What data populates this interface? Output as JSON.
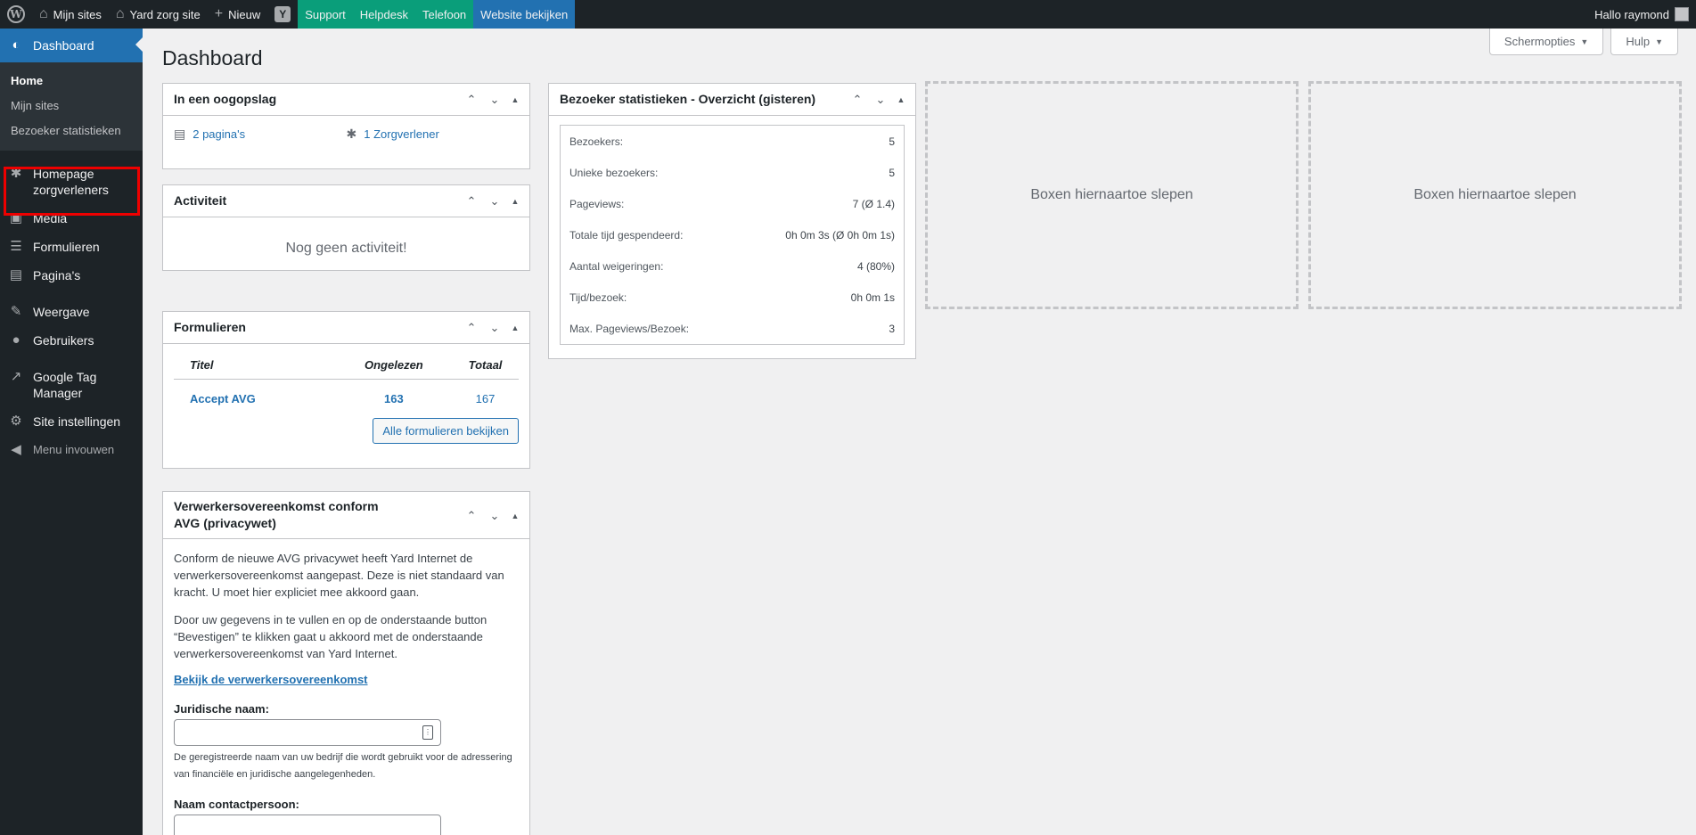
{
  "adminbar": {
    "my_sites": "Mijn sites",
    "site_name": "Yard zorg site",
    "new": "Nieuw",
    "yoast": "Y",
    "support": "Support",
    "helpdesk": "Helpdesk",
    "telefoon": "Telefoon",
    "website": "Website bekijken",
    "greeting": "Hallo raymond"
  },
  "sidebar": {
    "dashboard": "Dashboard",
    "sub": [
      "Home",
      "Mijn sites",
      "Bezoeker statistieken"
    ],
    "items": [
      {
        "label": "Homepage zorgverleners",
        "icon": "person-icon"
      },
      {
        "label": "Media",
        "icon": "media-icon"
      },
      {
        "label": "Formulieren",
        "icon": "forms-icon"
      },
      {
        "label": "Pagina's",
        "icon": "pages-icon"
      },
      {
        "label": "Weergave",
        "icon": "brush-icon"
      },
      {
        "label": "Gebruikers",
        "icon": "users-icon"
      },
      {
        "label": "Google Tag Manager",
        "icon": "chart-icon"
      },
      {
        "label": "Site instellingen",
        "icon": "gear-icon"
      }
    ],
    "collapse": "Menu invouwen"
  },
  "header": {
    "title": "Dashboard",
    "screen_options": "Schermopties",
    "help": "Hulp"
  },
  "glance": {
    "title": "In een oogopslag",
    "pages": "2 pagina's",
    "providers": "1 Zorgverlener"
  },
  "activity": {
    "title": "Activiteit",
    "empty": "Nog geen activiteit!"
  },
  "forms": {
    "title": "Formulieren",
    "headers": [
      "Titel",
      "Ongelezen",
      "Totaal"
    ],
    "rows": [
      {
        "title": "Accept AVG",
        "unread": "163",
        "total": "167"
      }
    ],
    "view_all": "Alle formulieren bekijken"
  },
  "avg": {
    "title": "Verwerkersovereenkomst conform AVG (privacywet)",
    "p1": "Conform de nieuwe AVG privacywet heeft Yard Internet de verwerkersovereenkomst aangepast. Deze is niet standaard van kracht. U moet hier expliciet mee akkoord gaan.",
    "p2": "Door uw gegevens in te vullen en op de onderstaande button “Bevestigen” te klikken gaat u akkoord met de onderstaande verwerkersovereenkomst van Yard Internet.",
    "link": "Bekijk de verwerkersovereenkomst",
    "legal_label": "Juridische naam:",
    "legal_value": "",
    "legal_desc": "De geregistreerde naam van uw bedrijf die wordt gebruikt voor de adressering van financiële en juridische aangelegenheden.",
    "contact_label": "Naam contactpersoon:",
    "contact_value": ""
  },
  "stats": {
    "title": "Bezoeker statistieken - Overzicht (gisteren)",
    "rows": [
      {
        "label": "Bezoekers:",
        "value": "5"
      },
      {
        "label": "Unieke bezoekers:",
        "value": "5"
      },
      {
        "label": "Pageviews:",
        "value": "7 (Ø 1.4)"
      },
      {
        "label": "Totale tijd gespendeerd:",
        "value": "0h 0m 3s (Ø 0h 0m 1s)"
      },
      {
        "label": "Aantal weigeringen:",
        "value": "4 (80%)"
      },
      {
        "label": "Tijd/bezoek:",
        "value": "0h 0m 1s"
      },
      {
        "label": "Max. Pageviews/Bezoek:",
        "value": "3"
      }
    ]
  },
  "dropzones": [
    "Boxen hiernaartoe slepen",
    "Boxen hiernaartoe slepen"
  ]
}
